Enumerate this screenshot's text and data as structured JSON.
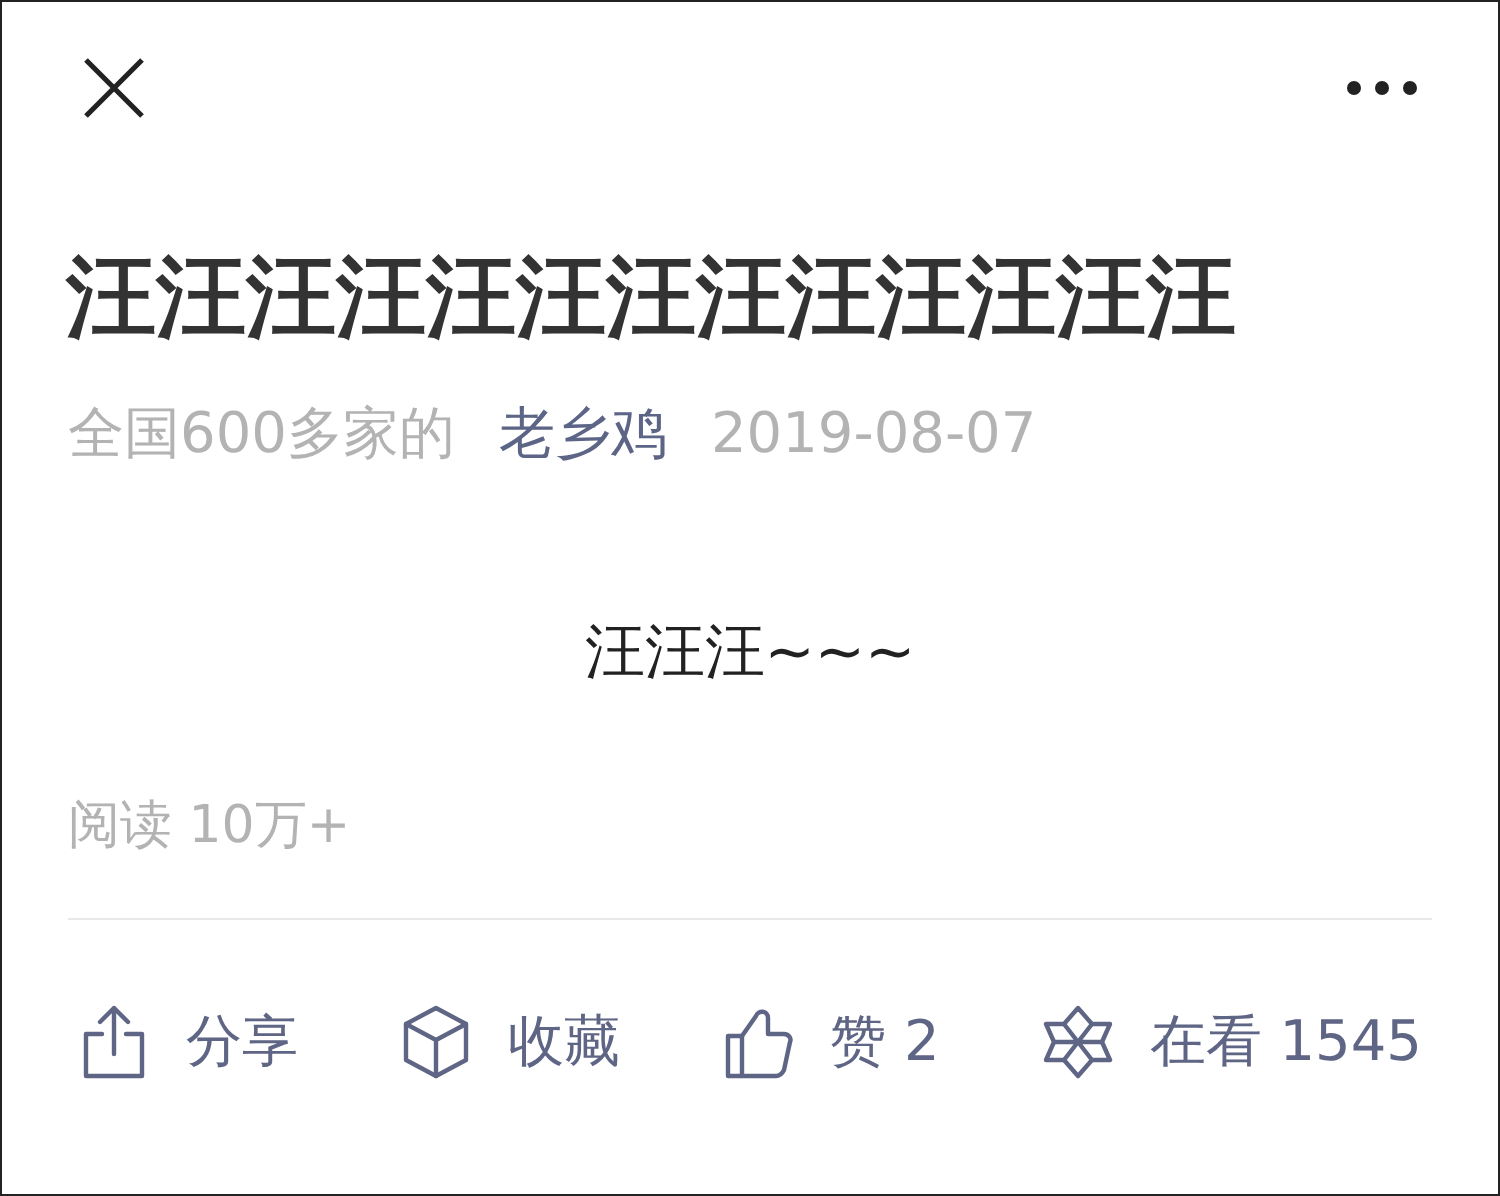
{
  "article": {
    "title": "汪汪汪汪汪汪汪汪汪汪汪汪汪",
    "source": "全国600多家的",
    "author": "老乡鸡",
    "date": "2019-08-07",
    "body": "汪汪汪~~~",
    "reads": "阅读 10万+"
  },
  "actions": [
    {
      "kind": "share",
      "label": "分享"
    },
    {
      "kind": "collect",
      "label": "收藏"
    },
    {
      "kind": "like",
      "label": "赞 2"
    },
    {
      "kind": "watch",
      "label": "在看 1545"
    }
  ]
}
